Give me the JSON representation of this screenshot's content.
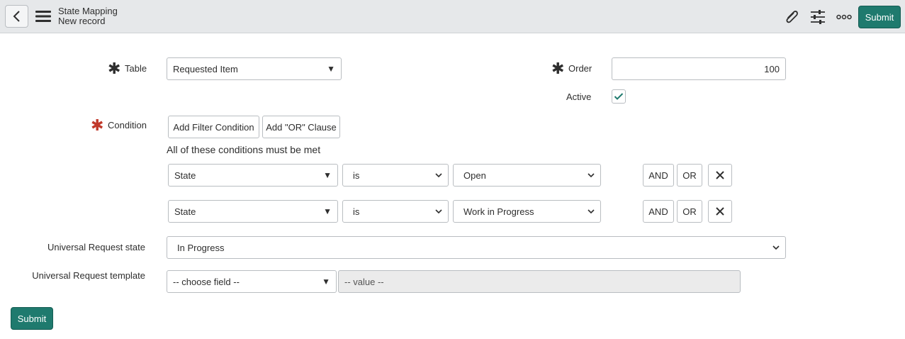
{
  "header": {
    "title": "State Mapping",
    "subtitle": "New record",
    "submit_label": "Submit",
    "icons": [
      "back-icon",
      "menu-icon",
      "paperclip-icon",
      "settings-sliders-icon",
      "more-icon"
    ]
  },
  "form": {
    "table": {
      "label": "Table",
      "value": "Requested Item"
    },
    "order": {
      "label": "Order",
      "value": "100"
    },
    "active": {
      "label": "Active",
      "checked": true
    },
    "condition": {
      "label": "Condition",
      "add_filter_label": "Add Filter Condition",
      "add_or_label": "Add \"OR\" Clause",
      "heading": "All of these conditions must be met",
      "rows": [
        {
          "field": "State",
          "operator": "is",
          "value": "Open",
          "and_label": "AND",
          "or_label": "OR"
        },
        {
          "field": "State",
          "operator": "is",
          "value": "Work in Progress",
          "and_label": "AND",
          "or_label": "OR"
        }
      ]
    },
    "universal_request_state": {
      "label": "Universal Request state",
      "value": "In Progress"
    },
    "universal_request_template": {
      "label": "Universal Request template",
      "field_placeholder": "-- choose field --",
      "value_placeholder": "-- value --"
    },
    "submit_label": "Submit"
  },
  "colors": {
    "accent": "#1f7a6e",
    "header_bg": "#e6e8ea",
    "required": "#c0392b"
  }
}
